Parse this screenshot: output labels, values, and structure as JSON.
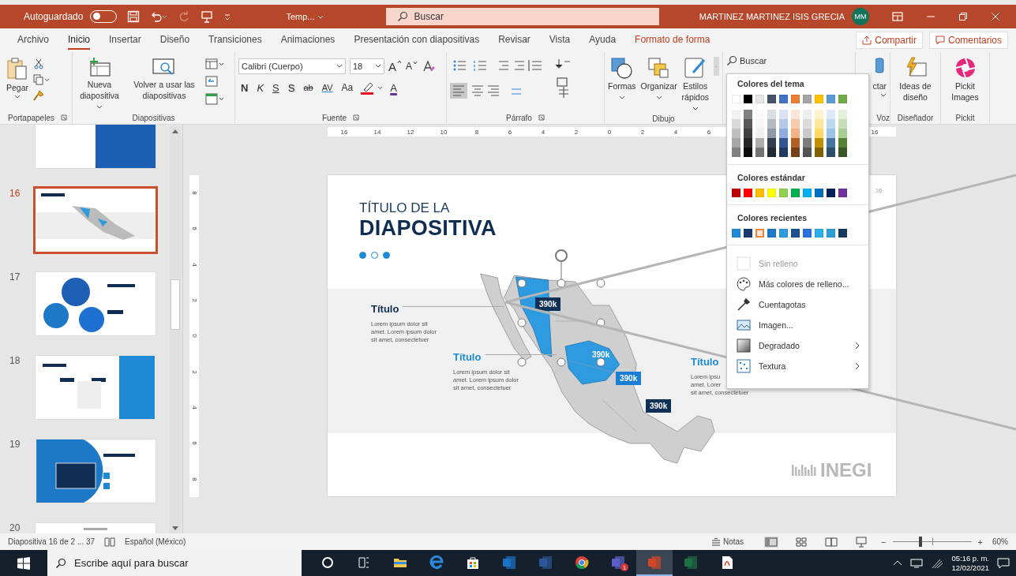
{
  "title_bar": {
    "autosave_label": "Autoguardado",
    "autosave_on": false,
    "file_name": "Temp...",
    "search_placeholder": "Buscar",
    "user_name": "MARTINEZ MARTINEZ ISIS GRECIA",
    "user_initials": "MM"
  },
  "tabs": [
    {
      "label": "Archivo",
      "selected": false,
      "kind": "normal"
    },
    {
      "label": "Inicio",
      "selected": true,
      "kind": "normal"
    },
    {
      "label": "Insertar",
      "selected": false,
      "kind": "normal"
    },
    {
      "label": "Diseño",
      "selected": false,
      "kind": "normal"
    },
    {
      "label": "Transiciones",
      "selected": false,
      "kind": "normal"
    },
    {
      "label": "Animaciones",
      "selected": false,
      "kind": "normal"
    },
    {
      "label": "Presentación con diapositivas",
      "selected": false,
      "kind": "normal"
    },
    {
      "label": "Revisar",
      "selected": false,
      "kind": "normal"
    },
    {
      "label": "Vista",
      "selected": false,
      "kind": "normal"
    },
    {
      "label": "Ayuda",
      "selected": false,
      "kind": "normal"
    },
    {
      "label": "Formato de forma",
      "selected": false,
      "kind": "contextual"
    }
  ],
  "share_buttons": [
    {
      "kind": "share",
      "label": "Compartir"
    },
    {
      "kind": "comments",
      "label": "Comentarios"
    }
  ],
  "ribbon": {
    "clipboard": {
      "label": "Portapapeles",
      "paste": "Pegar"
    },
    "slides": {
      "label": "Diapositivas",
      "new_slide": "Nueva diapositiva",
      "reuse": "Volver a usar las diapositivas"
    },
    "font": {
      "label": "Fuente",
      "family": "Calibri (Cuerpo)",
      "size": "18",
      "grow": "A",
      "shrink": "A",
      "font_color": "A",
      "format_buttons": [
        {
          "kind": "bold",
          "text": "N"
        },
        {
          "kind": "italic",
          "text": "K"
        },
        {
          "kind": "underline",
          "text": "S"
        },
        {
          "kind": "shadow",
          "text": "S"
        },
        {
          "kind": "strike",
          "text": "ab"
        },
        {
          "kind": "spacing",
          "text": "AV"
        },
        {
          "kind": "case",
          "text": "Aa"
        }
      ]
    },
    "paragraph": {
      "label": "Párrafo"
    },
    "drawing": {
      "label": "Dibujo",
      "buttons": [
        {
          "kind": "shapes",
          "label": "Formas"
        },
        {
          "kind": "arrange",
          "label": "Organizar"
        },
        {
          "kind": "styles",
          "label": "Estilos rápidos"
        }
      ]
    },
    "find": {
      "label": "Buscar"
    },
    "voice": {
      "button": "ctar",
      "label": "Voz"
    },
    "designer": {
      "button": "Ideas de diseño",
      "label": "Diseñador"
    },
    "pickit": {
      "button": "Pickit Images",
      "label": "Pickit"
    }
  },
  "ruler": {
    "left_labels": [
      "16",
      "14",
      "12",
      "10",
      "8",
      "6",
      "4",
      "2"
    ],
    "center": "0",
    "right_labels": [
      "2",
      "4",
      "6"
    ],
    "right_end": "16",
    "vertical_labels": [
      "8",
      "6",
      "4",
      "2",
      "0",
      "2",
      "4",
      "6",
      "8"
    ]
  },
  "thumbnails": [
    {
      "kind": "cover",
      "selected": false
    },
    {
      "number": "16",
      "kind": "map",
      "selected": true
    },
    {
      "number": "17",
      "kind": "circles",
      "selected": false
    },
    {
      "number": "18",
      "kind": "cards",
      "selected": false
    },
    {
      "number": "19",
      "kind": "laptop",
      "selected": false
    },
    {
      "number": "20",
      "kind": "title",
      "selected": false
    }
  ],
  "slide": {
    "page_number": "16",
    "title_small": "TÍTULO DE LA",
    "title_large": "DIAPOSITIVA",
    "dots": [
      {
        "filled": true
      },
      {
        "filled": false
      },
      {
        "filled": true
      }
    ],
    "callouts": [
      {
        "kind": "dark",
        "heading": "Título",
        "lines": [
          "Lorem ipsum dolor sit",
          "amet. Lorem ipsum dolor",
          "sit amet, consectetuer"
        ]
      },
      {
        "kind": "blue",
        "heading": "Título",
        "lines": [
          "Lorem ipsum dolor sit",
          "amet. Lorem ipsum dolor",
          "sit amet, consectetuer"
        ]
      },
      {
        "kind": "blue",
        "heading": "Título",
        "lines": [
          "Lorem ipsu",
          "amet. Lorer",
          "sit amet, consectetuer"
        ]
      }
    ],
    "map_labels": [
      {
        "kind": "dark",
        "text": "390k"
      },
      {
        "kind": "plain",
        "text": "390k"
      },
      {
        "kind": "blue",
        "text": "390k"
      },
      {
        "kind": "dark",
        "text": "390k"
      }
    ],
    "logo": "INEGI"
  },
  "fill_menu": {
    "theme_heading": "Colores del tema",
    "theme_colors": [
      {
        "color": "#ffffff"
      },
      {
        "color": "#000000"
      },
      {
        "color": "#e7e6e6"
      },
      {
        "color": "#44546a"
      },
      {
        "color": "#4472c4"
      },
      {
        "color": "#ed7d31"
      },
      {
        "color": "#a5a5a5"
      },
      {
        "color": "#ffc000"
      },
      {
        "color": "#5b9bd5"
      },
      {
        "color": "#70ad47"
      }
    ],
    "standard_heading": "Colores estándar",
    "standard_colors": [
      {
        "color": "#c00000"
      },
      {
        "color": "#ff0000"
      },
      {
        "color": "#ffc000"
      },
      {
        "color": "#ffff00"
      },
      {
        "color": "#92d050"
      },
      {
        "color": "#00b050"
      },
      {
        "color": "#00b0f0"
      },
      {
        "color": "#0070c0"
      },
      {
        "color": "#002060"
      },
      {
        "color": "#7030a0"
      }
    ],
    "recent_heading": "Colores recientes",
    "recent_colors": [
      {
        "color": "#1f8ad8",
        "selected": false
      },
      {
        "color": "#1b3b6f",
        "selected": false
      },
      {
        "color": "#fbe5d6",
        "selected": true
      },
      {
        "color": "#1e78c8",
        "selected": false
      },
      {
        "color": "#2e9ae0",
        "selected": false
      },
      {
        "color": "#1d4e8f",
        "selected": false
      },
      {
        "color": "#2a6fdb",
        "selected": false
      },
      {
        "color": "#28aee8",
        "selected": false
      },
      {
        "color": "#2a9fd6",
        "selected": false
      },
      {
        "color": "#163a5f",
        "selected": false
      }
    ],
    "items": [
      {
        "kind": "no-fill",
        "label": "Sin relleno",
        "disabled": true,
        "submenu": false
      },
      {
        "kind": "more-colors",
        "label": "Más colores de relleno...",
        "disabled": false,
        "submenu": false
      },
      {
        "kind": "eyedropper",
        "label": "Cuentagotas",
        "disabled": false,
        "submenu": false
      },
      {
        "kind": "picture",
        "label": "Imagen...",
        "disabled": false,
        "submenu": false
      },
      {
        "kind": "gradient",
        "label": "Degradado",
        "disabled": false,
        "submenu": true
      },
      {
        "kind": "texture",
        "label": "Textura",
        "disabled": false,
        "submenu": true
      }
    ]
  },
  "status_bar": {
    "slide_info": "Diapositiva 16 de 2 ... 37",
    "language": "Español (México)",
    "notes": "Notas",
    "zoom_out": "−",
    "zoom_slider": {
      "level": 0.35
    },
    "zoom_in": "+",
    "zoom": "60%"
  },
  "taskbar": {
    "search_placeholder": "Escribe aquí para buscar",
    "apps": [
      {
        "kind": "cortana",
        "active": false
      },
      {
        "kind": "task-view",
        "active": false
      },
      {
        "kind": "explorer",
        "active": false
      },
      {
        "kind": "edge",
        "active": false
      },
      {
        "kind": "store",
        "active": false
      },
      {
        "kind": "outlook",
        "active": false
      },
      {
        "kind": "word",
        "active": false
      },
      {
        "kind": "chrome",
        "active": false
      },
      {
        "kind": "teams",
        "active": false,
        "badge": "1"
      },
      {
        "kind": "powerpoint",
        "active": true
      },
      {
        "kind": "excel",
        "active": false
      },
      {
        "kind": "pdf",
        "active": false
      }
    ],
    "time": "05:16 p. m.",
    "date": "12/02/2021"
  }
}
